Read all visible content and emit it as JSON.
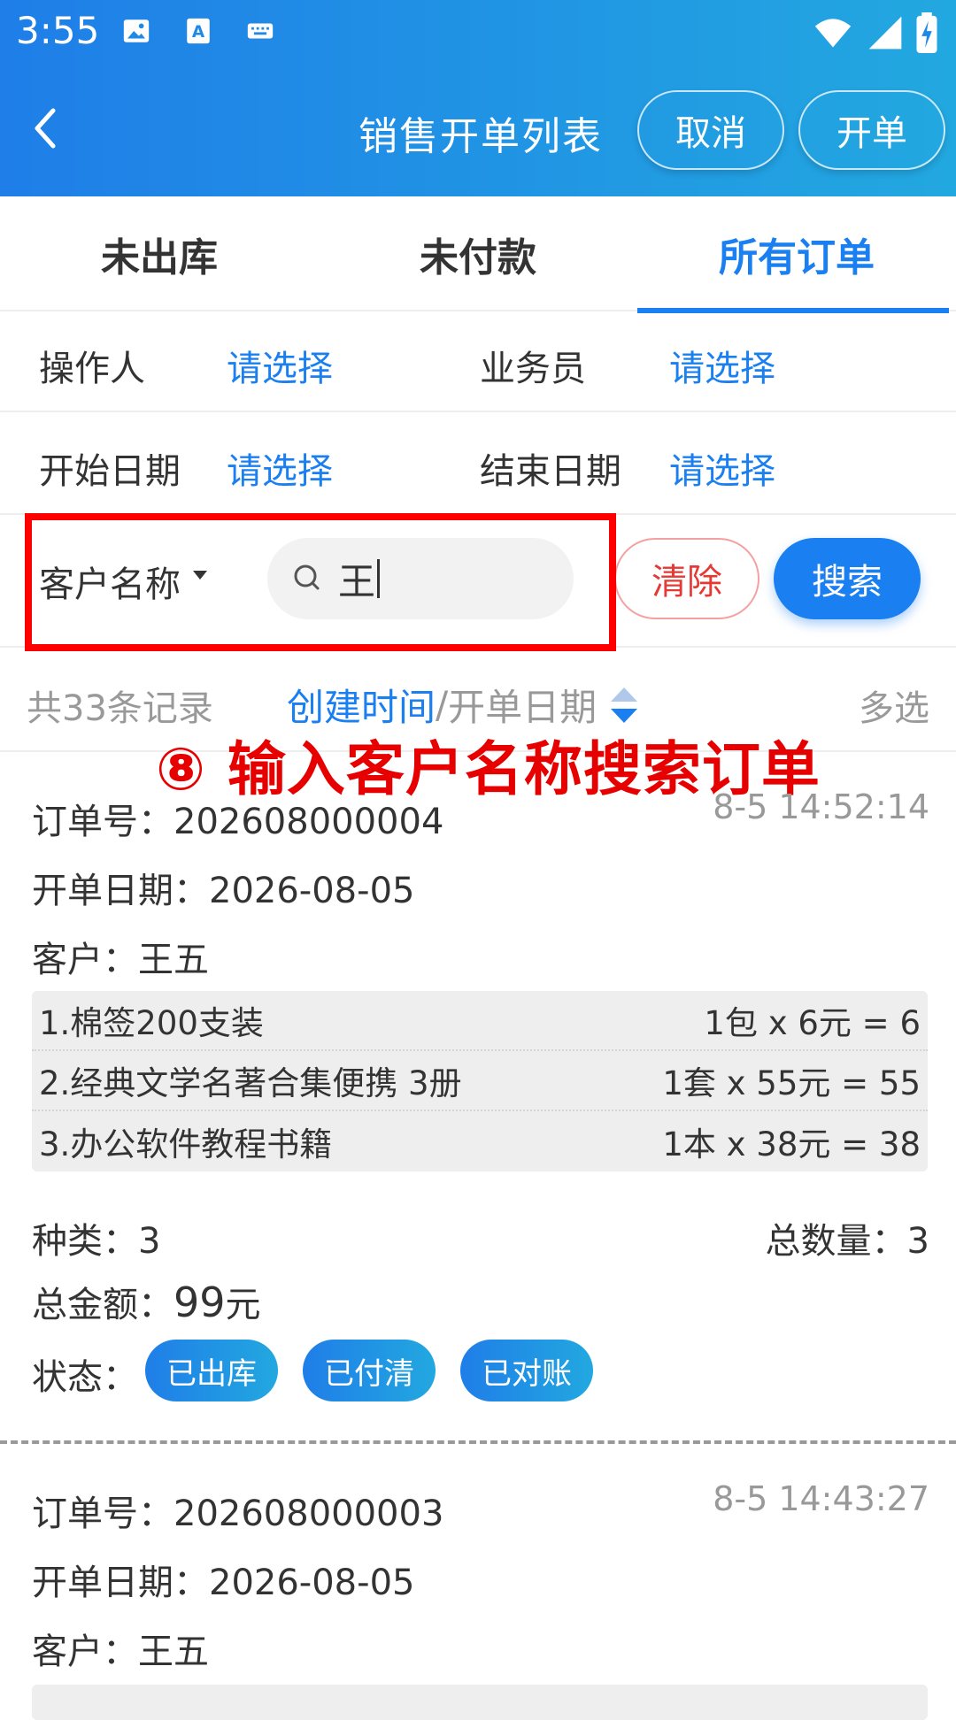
{
  "status_bar": {
    "time": "3:55"
  },
  "nav": {
    "back_label": "",
    "title": "销售开单列表",
    "cancel_label": "取消",
    "open_label": "开单"
  },
  "tabs": [
    {
      "label": "未出库",
      "active": false
    },
    {
      "label": "未付款",
      "active": false
    },
    {
      "label": "所有订单",
      "active": true
    }
  ],
  "filters": {
    "operator_label": "操作人",
    "operator_value": "请选择",
    "salesman_label": "业务员",
    "salesman_value": "请选择",
    "start_label": "开始日期",
    "start_value": "请选择",
    "end_label": "结束日期",
    "end_value": "请选择"
  },
  "search": {
    "field_label": "客户名称",
    "value": "王",
    "clear_label": "清除",
    "search_label": "搜索"
  },
  "list_meta": {
    "count_text": "共33条记录",
    "sort_active": "创建时间",
    "sort_sep": "/",
    "sort_other": "开单日期",
    "multi_select": "多选"
  },
  "annotation": "⑧ 输入客户名称搜索订单",
  "orders": [
    {
      "order_no_label": "订单号：",
      "order_no": "202608000004",
      "time": "8-5 14:52:14",
      "date_label": "开单日期：",
      "date": "2026-08-05",
      "customer_label": "客户：",
      "customer": "王五",
      "items": [
        {
          "name": "1.棉签200支装",
          "calc": "1包 x 6元 = 6"
        },
        {
          "name": "2.经典文学名著合集便携 3册",
          "calc": "1套 x 55元 = 55"
        },
        {
          "name": "3.办公软件教程书籍",
          "calc": "1本 x 38元 = 38"
        }
      ],
      "kinds_label": "种类：",
      "kinds": "3",
      "qty_label": "总数量：",
      "qty": "3",
      "amount_label": "总金额：",
      "amount": "99",
      "amount_unit": "元",
      "status_label": "状态：",
      "badges": [
        "已出库",
        "已付清",
        "已对账"
      ]
    },
    {
      "order_no_label": "订单号：",
      "order_no": "202608000003",
      "time": "8-5 14:43:27",
      "date_label": "开单日期：",
      "date": "2026-08-05",
      "customer_label": "客户：",
      "customer": "王五"
    }
  ]
}
